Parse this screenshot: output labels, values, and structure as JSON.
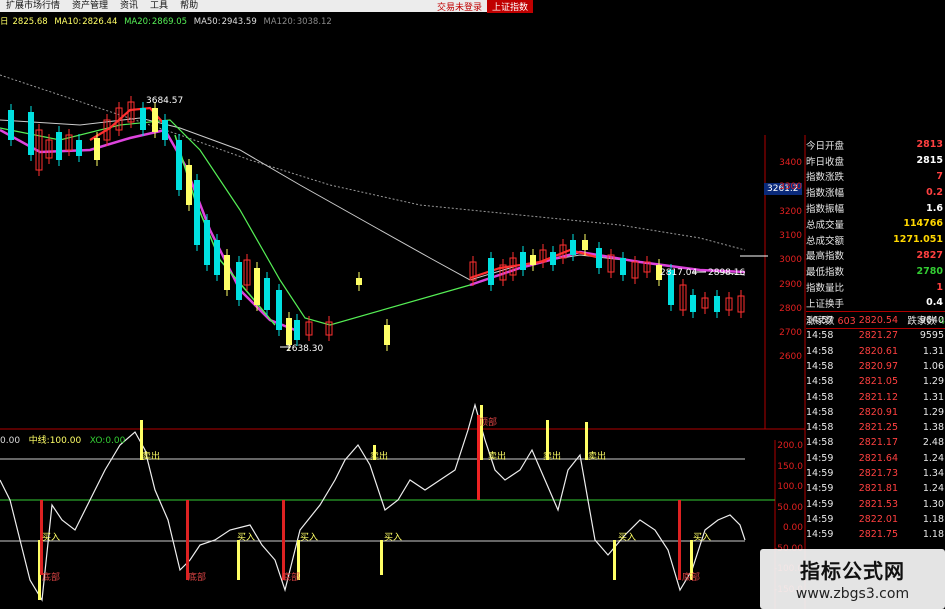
{
  "menu": {
    "items": [
      "扩展市场行情",
      "资产管理",
      "资讯",
      "工具",
      "帮助"
    ],
    "right": [
      "交易未登录",
      "上证指数"
    ]
  },
  "ma_row": {
    "prefix": "日",
    "ma5": "2825.68",
    "ma10_label": "MA10:",
    "ma10": "2826.44",
    "ma20_label": "MA20:",
    "ma20": "2869.05",
    "ma50_label": "MA50:",
    "ma50": "2943.59",
    "ma120_label": "MA120:",
    "ma120": "3038.12"
  },
  "annotations": {
    "high": "3684.57",
    "low": "2638.30",
    "range_a": "2817.04",
    "range_b": "2898.16",
    "price_tag": "3261.2"
  },
  "y_axis": [
    "3400",
    "3300",
    "3200",
    "3100",
    "3000",
    "2900",
    "2800",
    "2700",
    "2600"
  ],
  "ind_axis": [
    "200.0",
    "150.0",
    "100.0",
    "50.00",
    "0.00",
    "-50.00",
    "-100.0",
    "-150.0"
  ],
  "indicator_row": {
    "a": "0.00",
    "mid_label": "中线:",
    "mid": "100.00",
    "xo_label": "XO:",
    "xo": "0.00"
  },
  "signals": {
    "sell": "卖出",
    "buy": "买入",
    "bottom": "底部",
    "top": "顶部"
  },
  "panel": {
    "rows": [
      {
        "label": "今日开盘",
        "value": "2813",
        "color": "#ff4040"
      },
      {
        "label": "昨日收盘",
        "value": "2815",
        "color": "#ffffff"
      },
      {
        "label": "指数涨跌",
        "value": "7",
        "color": "#ff4040"
      },
      {
        "label": "指数涨幅",
        "value": "0.2",
        "color": "#ff4040"
      },
      {
        "label": "指数振幅",
        "value": "1.6",
        "color": "#ffffff"
      },
      {
        "label": "总成交量",
        "value": "114766",
        "color": "#ffd700"
      },
      {
        "label": "总成交额",
        "value": "1271.051",
        "color": "#ffd700"
      },
      {
        "label": "最高指数",
        "value": "2827",
        "color": "#ff4040"
      },
      {
        "label": "最低指数",
        "value": "2780",
        "color": "#33cc33"
      },
      {
        "label": "指数量比",
        "value": "1",
        "color": "#ff4040"
      },
      {
        "label": "上证换手",
        "value": "0.4",
        "color": "#ffffff"
      }
    ],
    "updown": {
      "up_label": "涨家数",
      "up": "603",
      "down_label": "跌家数",
      "down": "4"
    }
  },
  "ticks": [
    {
      "t": "14:57",
      "p": "2820.54",
      "v": "9640"
    },
    {
      "t": "14:58",
      "p": "2821.27",
      "v": "9595"
    },
    {
      "t": "14:58",
      "p": "2820.61",
      "v": "1.31"
    },
    {
      "t": "14:58",
      "p": "2820.97",
      "v": "1.06"
    },
    {
      "t": "14:58",
      "p": "2821.05",
      "v": "1.29"
    },
    {
      "t": "14:58",
      "p": "2821.12",
      "v": "1.31"
    },
    {
      "t": "14:58",
      "p": "2820.91",
      "v": "1.29"
    },
    {
      "t": "14:58",
      "p": "2821.25",
      "v": "1.38"
    },
    {
      "t": "14:58",
      "p": "2821.17",
      "v": "2.48"
    },
    {
      "t": "14:59",
      "p": "2821.64",
      "v": "1.24"
    },
    {
      "t": "14:59",
      "p": "2821.73",
      "v": "1.34"
    },
    {
      "t": "14:59",
      "p": "2821.81",
      "v": "1.24"
    },
    {
      "t": "14:59",
      "p": "2821.53",
      "v": "1.30"
    },
    {
      "t": "14:59",
      "p": "2822.01",
      "v": "1.18"
    },
    {
      "t": "14:59",
      "p": "2821.75",
      "v": "1.18"
    }
  ],
  "watermark": {
    "title": "指标公式网",
    "url": "www.zbgs3.com"
  },
  "colors": {
    "up": "#ff3030",
    "down": "#00e0e0",
    "yellow": "#ffff66",
    "green": "#55ee55",
    "magenta": "#dd44dd",
    "white": "#dddddd"
  }
}
